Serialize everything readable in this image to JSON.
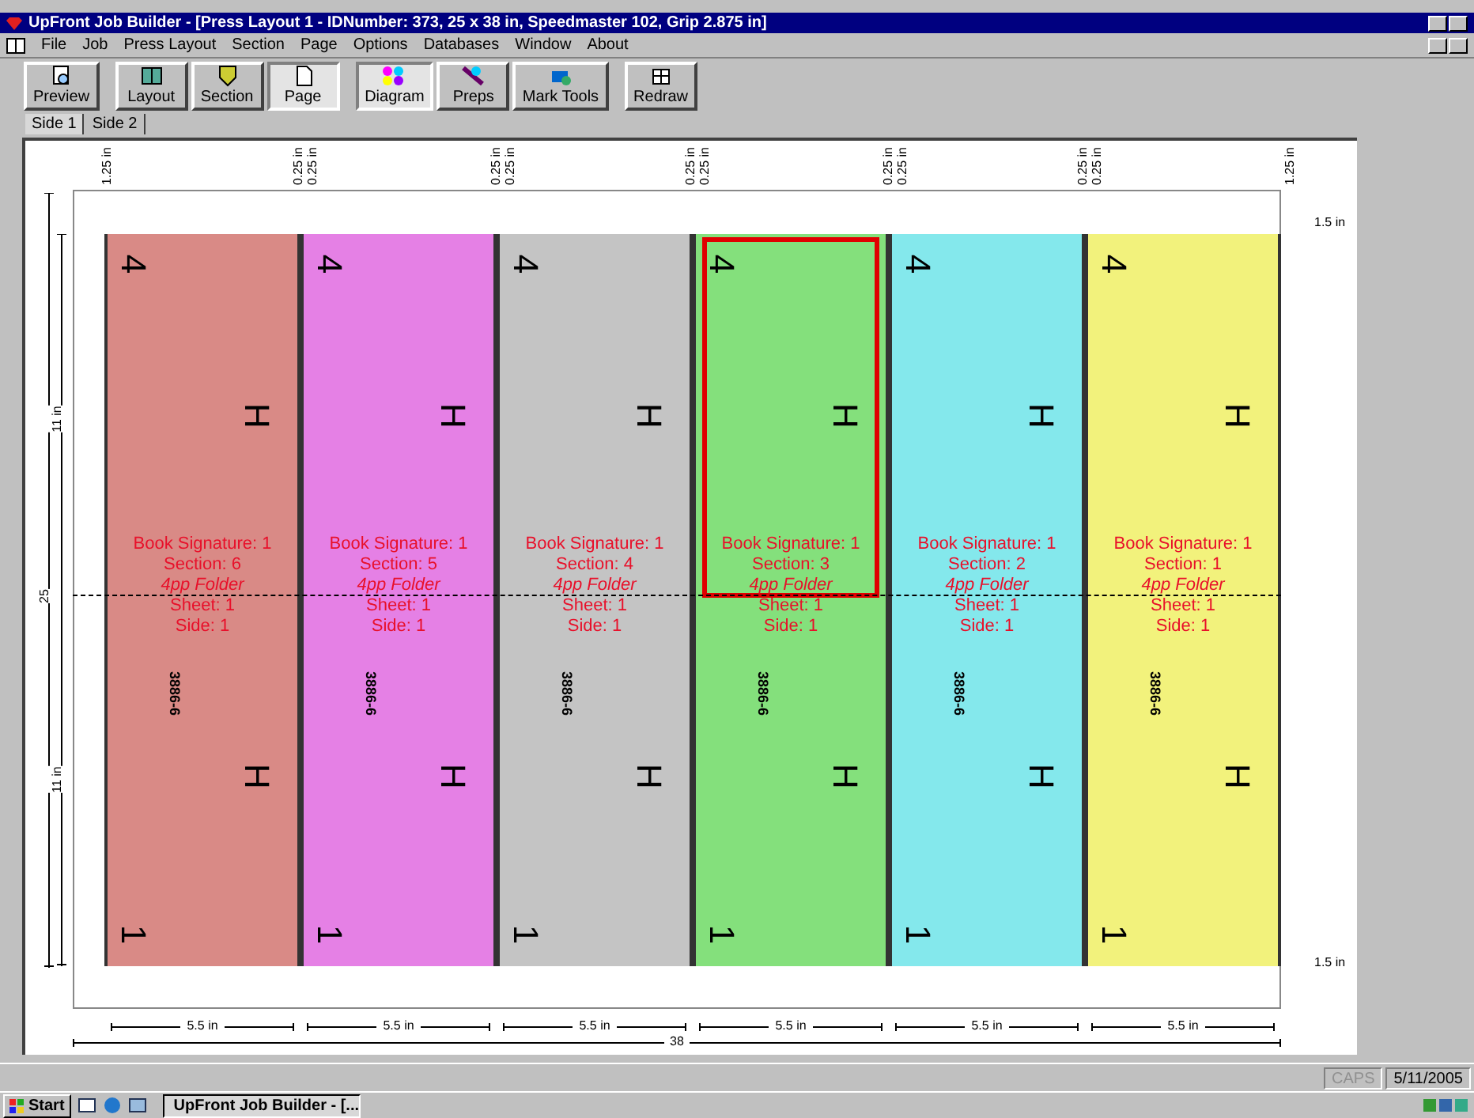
{
  "window": {
    "title": "UpFront Job Builder - [Press Layout 1 - IDNumber: 373, 25 x 38 in, Speedmaster 102, Grip 2.875 in]"
  },
  "menu": [
    "File",
    "Job",
    "Press Layout",
    "Section",
    "Page",
    "Options",
    "Databases",
    "Window",
    "About"
  ],
  "toolbar": [
    {
      "label": "Preview",
      "kind": "preview",
      "selected": false
    },
    {
      "label": "Layout",
      "kind": "layout",
      "selected": false
    },
    {
      "label": "Section",
      "kind": "section",
      "selected": false
    },
    {
      "label": "Page",
      "kind": "page",
      "selected": true
    },
    {
      "label": "Diagram",
      "kind": "diagram",
      "selected": true
    },
    {
      "label": "Preps",
      "kind": "preps",
      "selected": false
    },
    {
      "label": "Mark Tools",
      "kind": "marks",
      "selected": false
    },
    {
      "label": "Redraw",
      "kind": "redraw",
      "selected": false
    }
  ],
  "tabs": [
    {
      "label": "Side 1",
      "selected": true
    },
    {
      "label": "Side 2",
      "selected": false
    }
  ],
  "diagram": {
    "top_margins": [
      {
        "labels": [
          "1.25 in"
        ]
      },
      {
        "labels": [
          "0.25 in",
          "0.25 in"
        ]
      },
      {
        "labels": [
          "0.25 in",
          "0.25 in"
        ]
      },
      {
        "labels": [
          "0.25 in",
          "0.25 in"
        ]
      },
      {
        "labels": [
          "0.25 in",
          "0.25 in"
        ]
      },
      {
        "labels": [
          "0.25 in",
          "0.25 in"
        ]
      },
      {
        "labels": [
          "1.25 in"
        ]
      }
    ],
    "height_label": "25",
    "half_height_labels": [
      "11 in",
      "11 in"
    ],
    "right_margins": [
      "1.5 in",
      "1.5 in"
    ],
    "panels": [
      {
        "color": "#d98a86",
        "selected": false,
        "lines": [
          "Book Signature: 1",
          "Section: 6",
          "4pp Folder",
          "Sheet: 1",
          "Side: 1"
        ],
        "code": "3886-6",
        "top_mark": "4",
        "mid_marks": [
          "H",
          "H"
        ],
        "bottom_mark": "1",
        "width_label": "5.5 in"
      },
      {
        "color": "#e580e5",
        "selected": false,
        "lines": [
          "Book Signature: 1",
          "Section: 5",
          "4pp Folder",
          "Sheet: 1",
          "Side: 1"
        ],
        "code": "3886-6",
        "top_mark": "4",
        "mid_marks": [
          "H",
          "H"
        ],
        "bottom_mark": "1",
        "width_label": "5.5 in"
      },
      {
        "color": "#c4c4c4",
        "selected": false,
        "lines": [
          "Book Signature: 1",
          "Section: 4",
          "4pp Folder",
          "Sheet: 1",
          "Side: 1"
        ],
        "code": "3886-6",
        "top_mark": "4",
        "mid_marks": [
          "H",
          "H"
        ],
        "bottom_mark": "1",
        "width_label": "5.5 in"
      },
      {
        "color": "#84e07c",
        "selected": true,
        "lines": [
          "Book Signature: 1",
          "Section: 3",
          "4pp Folder",
          "Sheet: 1",
          "Side: 1"
        ],
        "code": "3886-6",
        "top_mark": "4",
        "mid_marks": [
          "H",
          "H"
        ],
        "bottom_mark": "1",
        "width_label": "5.5 in"
      },
      {
        "color": "#84e8ec",
        "selected": false,
        "lines": [
          "Book Signature: 1",
          "Section: 2",
          "4pp Folder",
          "Sheet: 1",
          "Side: 1"
        ],
        "code": "3886-6",
        "top_mark": "4",
        "mid_marks": [
          "H",
          "H"
        ],
        "bottom_mark": "1",
        "width_label": "5.5 in"
      },
      {
        "color": "#f2f27c",
        "selected": false,
        "lines": [
          "Book Signature: 1",
          "Section: 1",
          "4pp Folder",
          "Sheet: 1",
          "Side: 1"
        ],
        "code": "3886-6",
        "top_mark": "4",
        "mid_marks": [
          "H",
          "H"
        ],
        "bottom_mark": "1",
        "width_label": "5.5 in"
      }
    ],
    "total_width_label": "38"
  },
  "status_bar": {
    "caps": {
      "label": "CAPS",
      "on": false
    },
    "date": "5/11/2005"
  },
  "taskbar": {
    "start": "Start",
    "task": "UpFront Job Builder - [..."
  }
}
